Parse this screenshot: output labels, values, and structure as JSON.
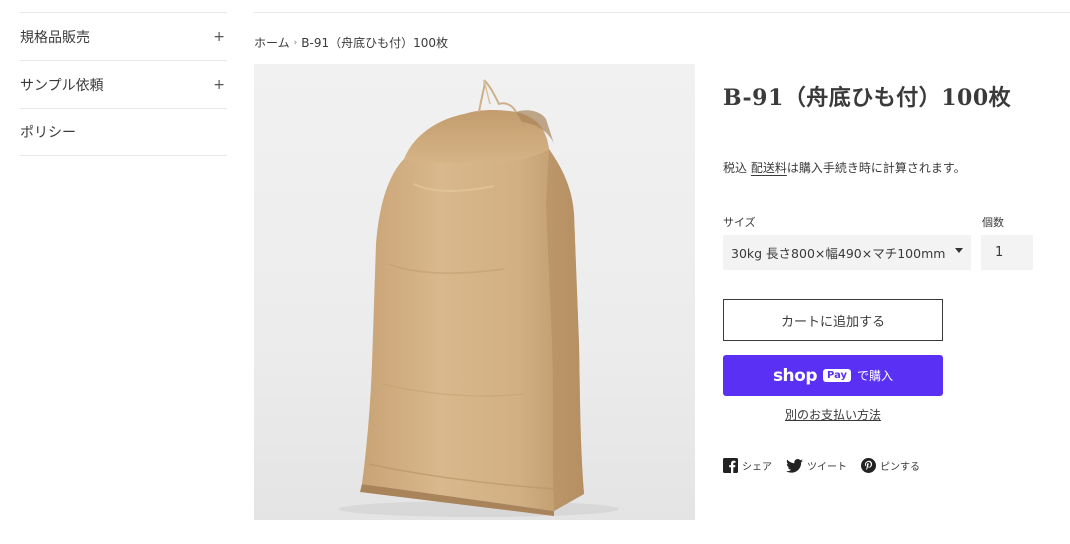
{
  "sidebar": {
    "items": [
      {
        "label": "規格品販売",
        "toggle": "+"
      },
      {
        "label": "サンプル依頼",
        "toggle": "+"
      },
      {
        "label": "ポリシー"
      }
    ]
  },
  "breadcrumb": {
    "home": "ホーム",
    "separator": "›",
    "current": "B-91（舟底ひも付）100枚"
  },
  "product": {
    "title": "B-91（舟底ひも付）100枚",
    "tax_prefix": "税込",
    "shipping_link": "配送料",
    "tax_suffix": "は購入手続き時に計算されます。",
    "size_label": "サイズ",
    "size_selected": "30kg 長さ800×幅490×マチ100mm",
    "qty_label": "個数",
    "qty_value": "1",
    "image_icon": "kraft-paper-bag-image"
  },
  "buttons": {
    "add_to_cart": "カートに追加する",
    "shop_pay_brand": "shop",
    "shop_pay_box": "Pay",
    "shop_pay_suffix": "で購入",
    "more_payment": "別のお支払い方法",
    "shop_pay_color": "#5a31f4"
  },
  "social": {
    "share": "シェア",
    "tweet": "ツイート",
    "pin": "ピンする",
    "icons": [
      "facebook-icon",
      "twitter-icon",
      "pinterest-icon"
    ]
  }
}
